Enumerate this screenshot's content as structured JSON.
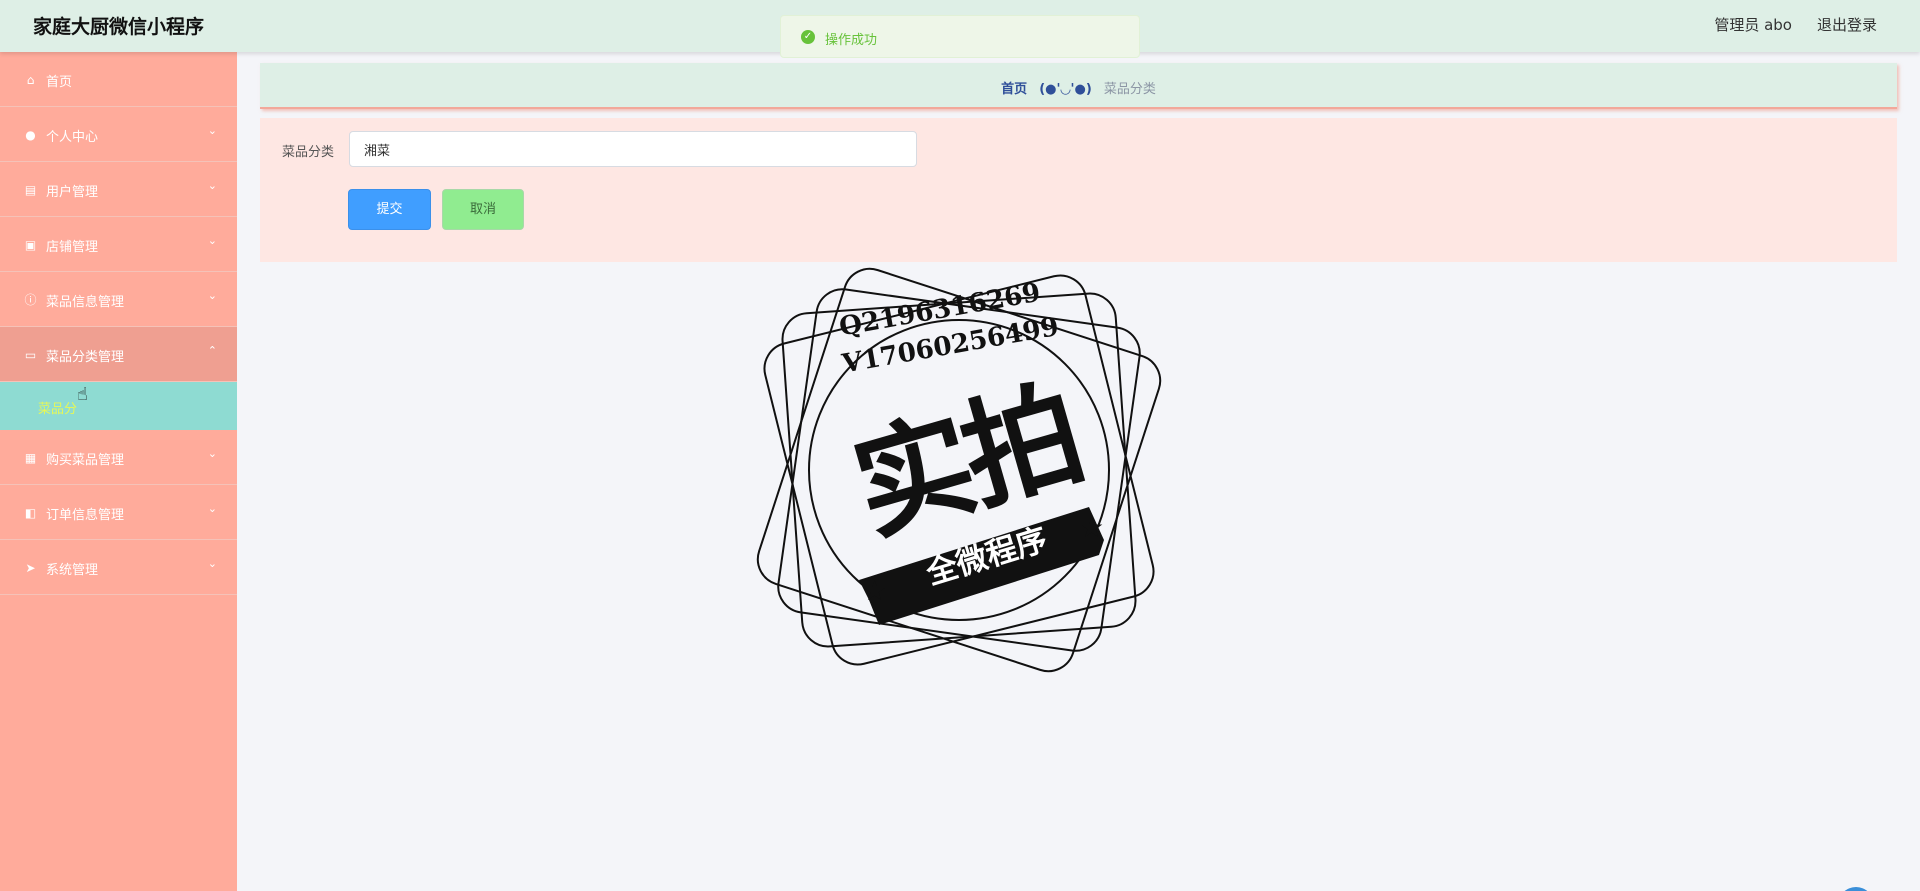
{
  "header": {
    "app_title": "家庭大厨微信小程序",
    "admin_label": "管理员 abo",
    "logout_label": "退出登录"
  },
  "toast": {
    "icon": "check-circle-icon",
    "message": "操作成功"
  },
  "sidebar": {
    "items": [
      {
        "label": "首页",
        "icon": "home-icon",
        "has_arrow": false
      },
      {
        "label": "个人中心",
        "icon": "user-icon",
        "has_arrow": true
      },
      {
        "label": "用户管理",
        "icon": "clipboard-icon",
        "has_arrow": true
      },
      {
        "label": "店铺管理",
        "icon": "store-icon",
        "has_arrow": true
      },
      {
        "label": "菜品信息管理",
        "icon": "info-icon",
        "has_arrow": true
      },
      {
        "label": "菜品分类管理",
        "icon": "monitor-icon",
        "has_arrow": true,
        "expanded": true
      },
      {
        "label": "购买菜品管理",
        "icon": "grid-icon",
        "has_arrow": true
      },
      {
        "label": "订单信息管理",
        "icon": "wallet-icon",
        "has_arrow": true
      },
      {
        "label": "系统管理",
        "icon": "send-icon",
        "has_arrow": true
      }
    ],
    "submenu_active": "菜品分"
  },
  "breadcrumb": {
    "home": "首页",
    "separator": "(●'◡'●)",
    "current": "菜品分类"
  },
  "form": {
    "label": "菜品分类",
    "value": "湘菜",
    "submit_label": "提交",
    "cancel_label": "取消"
  },
  "watermark": {
    "line1": "Q2196316269",
    "line2": "V17060256499",
    "big_text": "实拍",
    "banner_text": "全微程序"
  },
  "colors": {
    "topbar": "#deefe6",
    "sidebar": "#ffab9b",
    "submenu_active": "#8edbd2",
    "form_card": "#fee7e3",
    "primary": "#409eff",
    "cancel": "#90ec90",
    "success": "#67c23a"
  }
}
